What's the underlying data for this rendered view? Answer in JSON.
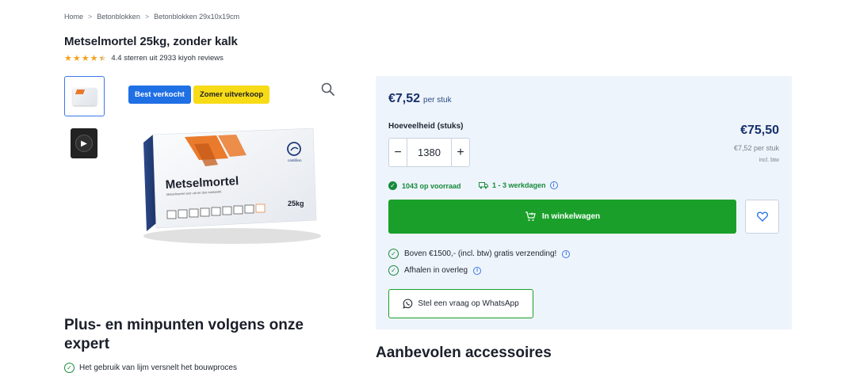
{
  "breadcrumb": {
    "items": [
      "Home",
      "Betonblokken",
      "Betonblokken 29x10x19cm"
    ],
    "separator": ">"
  },
  "product": {
    "title": "Metselmortel 25kg, zonder kalk",
    "rating_text": "4.4 sterren uit 2933 kiyoh reviews",
    "rating_value": 4.4,
    "rating_max": 5,
    "bag_brand": "Metselmortel",
    "bag_subtitle": "Metselmortel voor vol en dun metswerk",
    "bag_weight": "25kg",
    "bag_logo": "cantillion"
  },
  "badges": {
    "best_sold": "Best verkocht",
    "summer_sale": "Zomer uitverkoop"
  },
  "pricing": {
    "unit_price": "€7,52",
    "unit_label": "per stuk",
    "quantity_label": "Hoeveelheid (stuks)",
    "quantity_value": "1380",
    "minus": "−",
    "plus": "+",
    "total": "€75,50",
    "total_sub": "€7,52 per stuk",
    "total_btw": "incl. btw"
  },
  "availability": {
    "stock": "1043 op voorraad",
    "delivery": "1 - 3 werkdagen",
    "info_glyph": "i"
  },
  "actions": {
    "cart_label": "In winkelwagen",
    "whatsapp_label": "Stel een vraag op WhatsApp"
  },
  "usps": [
    "Boven €1500,- (incl. btw) gratis verzending!",
    "Afhalen in overleg"
  ],
  "sections": {
    "pros_cons_title": "Plus- en minpunten volgens onze expert",
    "accessories_title": "Aanbevolen accessoires",
    "first_point": "Het gebruik van lijm versnelt het bouwproces"
  },
  "colors": {
    "accent_blue": "#1f6fe5",
    "badge_yellow": "#f7db17",
    "cart_green": "#1aa02a",
    "price_navy": "#16306b",
    "panel_bg": "#eef4fb"
  },
  "icons": {
    "zoom": "magnifier-icon",
    "cart": "cart-plus-icon",
    "heart": "heart-icon",
    "whatsapp": "whatsapp-icon",
    "check": "check-circle-icon",
    "truck": "truck-icon",
    "info": "info-icon",
    "play": "play-icon",
    "star": "star-icon"
  }
}
